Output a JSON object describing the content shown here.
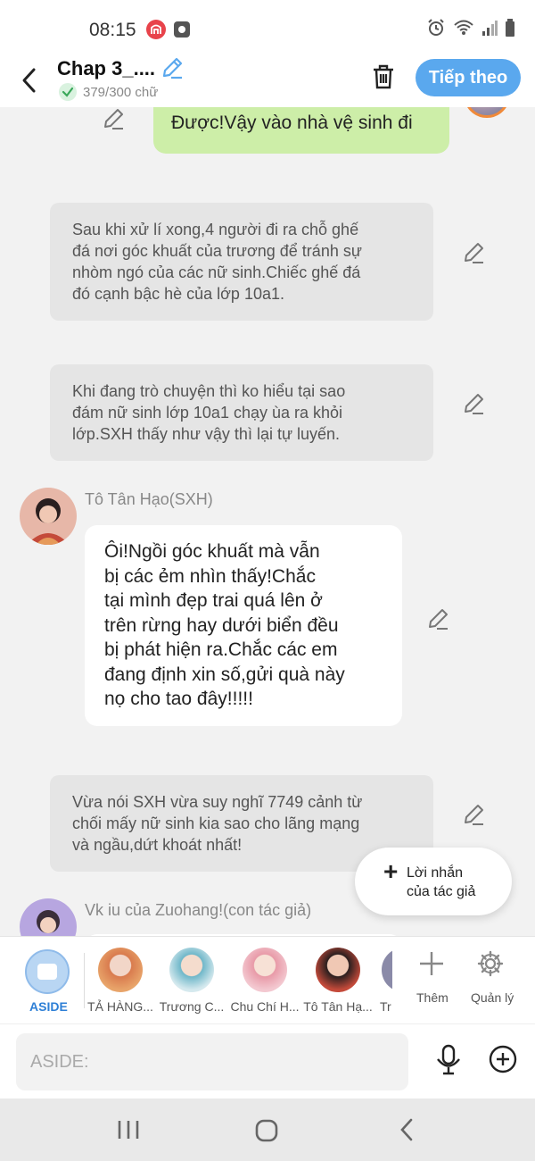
{
  "status": {
    "time": "08:15",
    "notif_colors": {
      "app1": "#e8434b",
      "app2": "#555555"
    }
  },
  "header": {
    "title": "Chap 3_....",
    "word_count": "379/300 chữ",
    "next_label": "Tiếp theo",
    "accent": "#5aa8ee",
    "icons": {
      "back": "back-arrow-icon",
      "edit": "pencil-icon",
      "trash": "trash-icon",
      "check": "check-icon"
    }
  },
  "messages": [
    {
      "kind": "user",
      "text": "Được!Vậy vào nhà vệ sinh đi",
      "bubble_color": "#cdeea8"
    },
    {
      "kind": "narration",
      "lines": [
        "Sau khi xử lí xong,4 người đi ra chỗ ghế",
        "đá nơi góc khuất của trương để tránh sự",
        "nhòm ngó của các nữ sinh.Chiếc ghế đá",
        "đó cạnh bậc hè của lớp 10a1."
      ]
    },
    {
      "kind": "narration",
      "lines": [
        "Khi đang trò chuyện thì ko hiểu tại sao",
        "đám nữ sinh lớp 10a1 chạy ùa ra khỏi",
        "lớp.SXH thấy như vậy thì lại tự luyến."
      ]
    },
    {
      "kind": "character",
      "name": "Tô Tân Hạo(SXH)",
      "lines": [
        "Ôi!Ngồi góc khuất mà vẫn",
        "bị các ẻm nhìn thấy!Chắc",
        "tại mình đẹp trai quá lên ở",
        "trên rừng hay dưới biển đều",
        "bị phát hiện ra.Chắc các em",
        "đang định xin số,gửi quà này",
        "nọ cho tao đây!!!!!"
      ]
    },
    {
      "kind": "narration",
      "lines": [
        "Vừa nói SXH vừa suy nghĩ 7749 cảnh từ",
        "chối mấy nữ sinh kia sao cho lãng mạng",
        "và ngầu,dứt khoát nhất!"
      ]
    },
    {
      "kind": "character",
      "name": "Vk iu của Zuohang!(con tác giả)"
    }
  ],
  "author_note": {
    "icon": "plus-icon",
    "label_line1": "Lời nhắn",
    "label_line2": "của tác giả"
  },
  "character_bar": {
    "aside_label": "ASIDE",
    "characters": [
      {
        "label": "TẢ HÀNG...",
        "color": "#d97b4e"
      },
      {
        "label": "Trương C...",
        "color": "#6fb7c9"
      },
      {
        "label": "Chu Chí H...",
        "color": "#e89aa8"
      },
      {
        "label": "Tô Tân Hạ...",
        "color": "#c44a3a"
      },
      {
        "label": "Tr",
        "color": "#8a8aa8"
      }
    ],
    "add_label": "Thêm",
    "manage_label": "Quản lý",
    "icons": {
      "add": "plus-icon",
      "manage": "gear-icon"
    }
  },
  "input": {
    "placeholder": "ASIDE:",
    "icons": {
      "mic": "microphone-icon",
      "add": "plus-circle-icon"
    }
  },
  "nav": {
    "icons": [
      "recents-icon",
      "home-icon",
      "back-icon"
    ]
  }
}
